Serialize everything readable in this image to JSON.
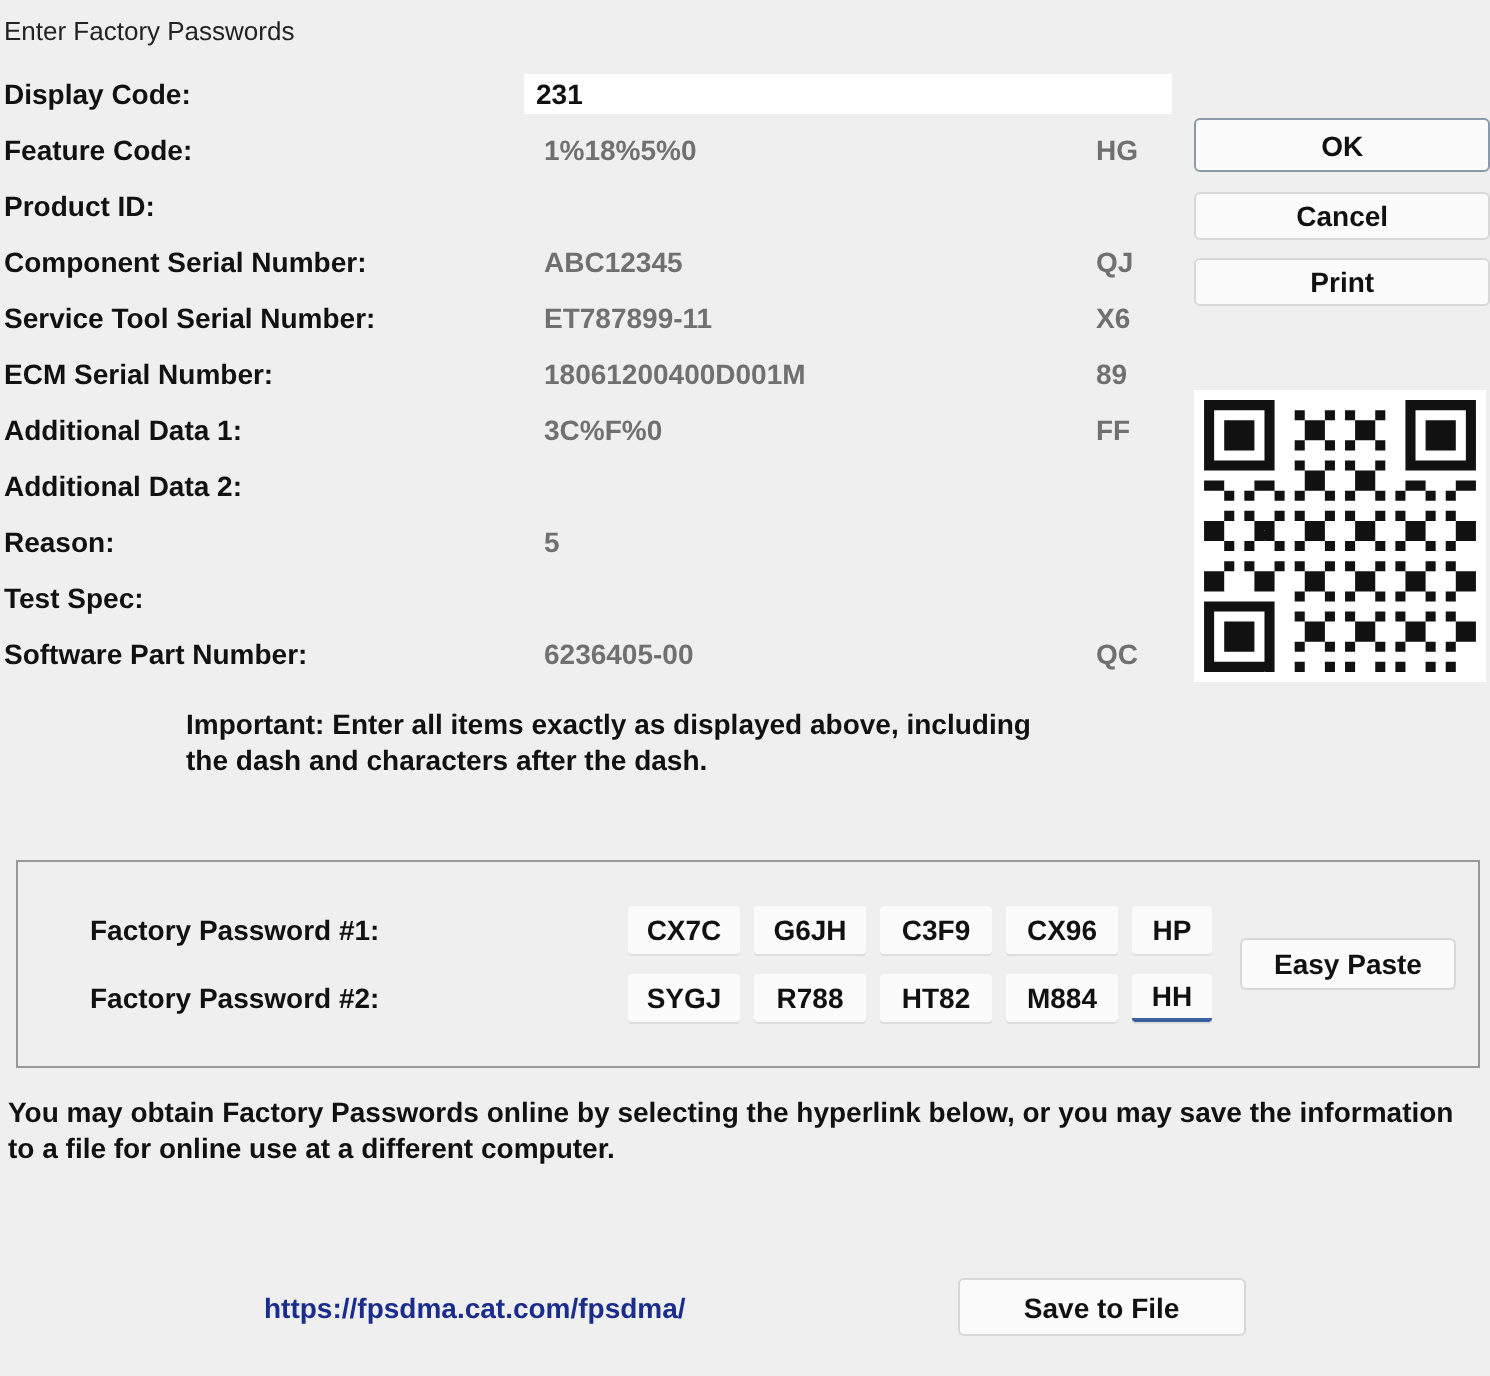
{
  "window": {
    "title": "Enter Factory Passwords"
  },
  "fields": [
    {
      "label": "Display Code:",
      "value": "231",
      "kind": "input"
    },
    {
      "label": "Feature Code:",
      "value": "1%18%5%0",
      "check": "HG",
      "kind": "readonly"
    },
    {
      "label": "Product ID:",
      "kind": "readonly"
    },
    {
      "label": "Component Serial Number:",
      "value": "ABC12345",
      "check": "QJ",
      "kind": "readonly"
    },
    {
      "label": "Service Tool Serial Number:",
      "value": "ET787899-11",
      "check": "X6",
      "kind": "readonly"
    },
    {
      "label": "ECM Serial Number:",
      "value": "18061200400D001M",
      "check": "89",
      "kind": "readonly"
    },
    {
      "label": "Additional Data 1:",
      "value": "3C%F%0",
      "check": "FF",
      "kind": "readonly"
    },
    {
      "label": "Additional Data 2:",
      "kind": "readonly"
    },
    {
      "label": "Reason:",
      "value": "5",
      "kind": "readonly"
    },
    {
      "label": "Test Spec:",
      "kind": "readonly"
    },
    {
      "label": "Software Part Number:",
      "value": "6236405-00",
      "check": "QC",
      "kind": "readonly"
    }
  ],
  "buttons": [
    {
      "label": "OK",
      "default": true
    },
    {
      "label": "Cancel",
      "default": false
    },
    {
      "label": "Print",
      "default": false
    }
  ],
  "note": "Important: Enter all items exactly as displayed above, including the dash and characters after the dash.",
  "passwords": [
    {
      "label": "Factory Password #1:",
      "parts": [
        {
          "value": "CX7C",
          "focused": false
        },
        {
          "value": "G6JH",
          "focused": false
        },
        {
          "value": "C3F9",
          "focused": false
        },
        {
          "value": "CX96",
          "focused": false
        },
        {
          "value": "HP",
          "focused": false
        }
      ]
    },
    {
      "label": "Factory Password #2:",
      "parts": [
        {
          "value": "SYGJ",
          "focused": false
        },
        {
          "value": "R788",
          "focused": false
        },
        {
          "value": "HT82",
          "focused": false
        },
        {
          "value": "M884",
          "focused": false
        },
        {
          "value": "HH",
          "focused": true
        }
      ]
    }
  ],
  "easy_paste": "Easy Paste",
  "info": "You may obtain Factory Passwords online by selecting the hyperlink below, or you may save the information to a file for online use at a different computer.",
  "link": "https://fpsdma.cat.com/fpsdma/",
  "save_button": "Save to File"
}
